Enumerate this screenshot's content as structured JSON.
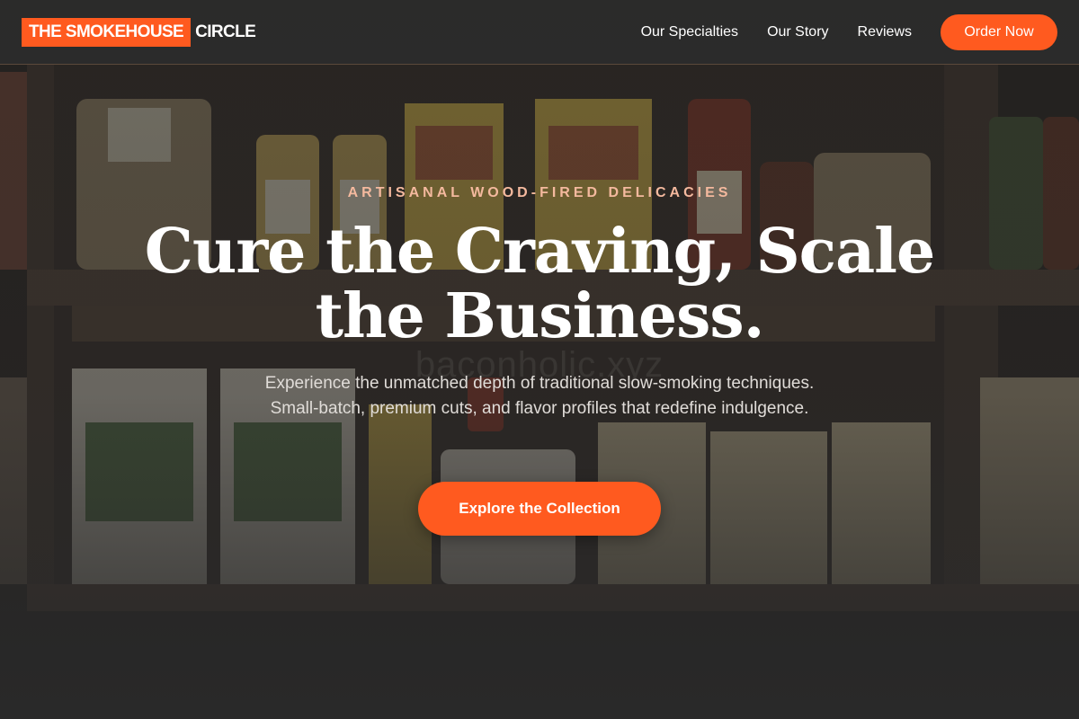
{
  "brand": {
    "logo_highlight": "THE SMOKEHOUSE",
    "logo_text": "CIRCLE"
  },
  "nav": {
    "links": [
      "Our Specialties",
      "Our Story",
      "Reviews"
    ],
    "cta_label": "Order Now"
  },
  "hero": {
    "eyebrow": "ARTISANAL WOOD-FIRED DELICACIES",
    "headline": "Cure the Craving, Scale the Business.",
    "subtext": "Experience the unmatched depth of traditional slow-smoking techniques. Small-batch, premium cuts, and flavor profiles that redefine indulgence.",
    "cta_label": "Explore the Collection",
    "background_watermark": "baconholic.xyz"
  },
  "colors": {
    "accent": "#ff5a1f",
    "navbar_bg": "#2c2c2c",
    "eyebrow": "#f4b99e",
    "text": "#ffffff"
  }
}
